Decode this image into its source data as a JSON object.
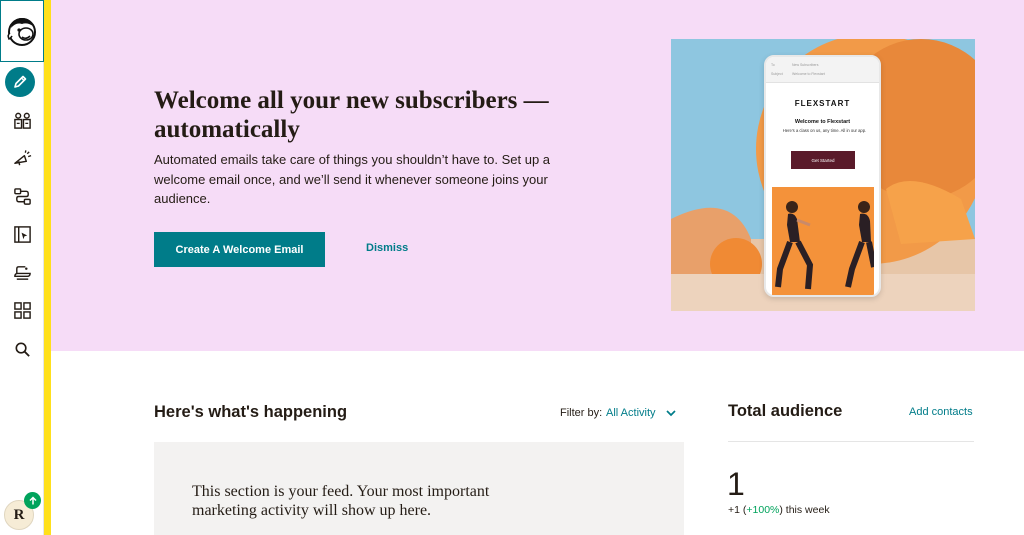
{
  "sidebar": {
    "logo_name": "mailchimp-freddie-logo",
    "create_icon": "pencil-icon",
    "items": [
      {
        "name": "audience-icon",
        "label": "Audience"
      },
      {
        "name": "campaigns-icon",
        "label": "Campaigns"
      },
      {
        "name": "automations-icon",
        "label": "Automations"
      },
      {
        "name": "website-icon",
        "label": "Website"
      },
      {
        "name": "content-icon",
        "label": "Content Studio"
      },
      {
        "name": "integrations-icon",
        "label": "Integrations"
      },
      {
        "name": "search-icon",
        "label": "Search"
      }
    ],
    "avatar_initial": "R",
    "avatar_badge_icon": "arrow-up-icon",
    "accent_color": "#ffe01b"
  },
  "hero": {
    "title": "Welcome all your new subscribers —automatically",
    "description": "Automated emails take care of things you shouldn’t have to. Set up a welcome email once, and we’ll send it whenever someone joins your audience.",
    "primary_button": "Create A Welcome Email",
    "dismiss": "Dismiss",
    "background_color": "#f6dcf7",
    "preview": {
      "to_label": "To",
      "to_value": "New Subscribers",
      "subject_label": "Subject",
      "subject_value": "Welcome to Flexstart",
      "brand": "FLEXSTART",
      "heading": "Welcome to Flexstart",
      "subtext": "Here’s a class on us, any time. All in our app.",
      "button": "Get Started"
    }
  },
  "feed": {
    "title": "Here's what's happening",
    "filter_label": "Filter by:",
    "filter_value": "All Activity",
    "message": "This section is your feed. Your most important marketing activity will show up here."
  },
  "audience": {
    "title": "Total audience",
    "add_contacts": "Add contacts",
    "count": "1",
    "change_prefix": "+1 (",
    "change_pct": "+100%",
    "change_suffix": ") this week"
  },
  "colors": {
    "primary": "#007c89",
    "positive": "#00a35c"
  }
}
